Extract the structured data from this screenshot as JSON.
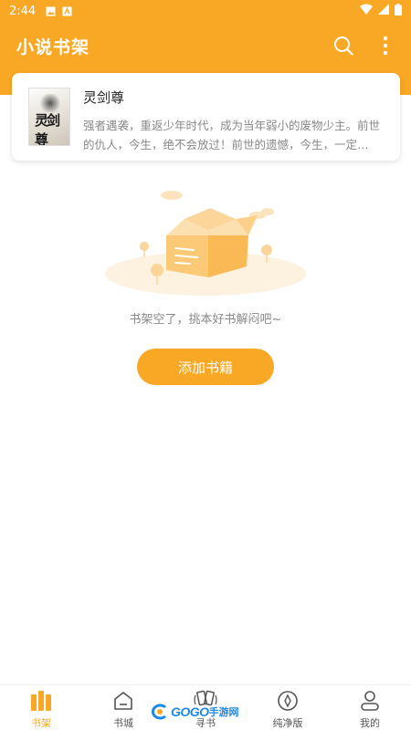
{
  "status_bar": {
    "time": "2:44"
  },
  "app_bar": {
    "title": "小说书架",
    "search_icon": "search-icon",
    "more_icon": "more-vertical-icon"
  },
  "book": {
    "title": "灵剑尊",
    "description": "强者遇袭，重返少年时代，成为当年弱小的废物少主。前世的仇人，今生，绝不会放过！前世的遗憾，今生，一定…",
    "cover_text": "灵剑尊"
  },
  "empty_state": {
    "message": "书架空了，挑本好书解闷吧~",
    "button_label": "添加书籍"
  },
  "bottom_nav": {
    "items": [
      {
        "label": "书架",
        "icon": "bookshelf-icon",
        "active": true
      },
      {
        "label": "书城",
        "icon": "store-icon"
      },
      {
        "label": "寻书",
        "icon": "find-book-icon"
      },
      {
        "label": "纯净版",
        "icon": "compass-icon"
      },
      {
        "label": "我的",
        "icon": "profile-icon"
      }
    ]
  },
  "watermark": {
    "text": "GOGO",
    "cn": "手游网"
  },
  "colors": {
    "accent": "#f9a825",
    "text_muted": "#888888"
  }
}
